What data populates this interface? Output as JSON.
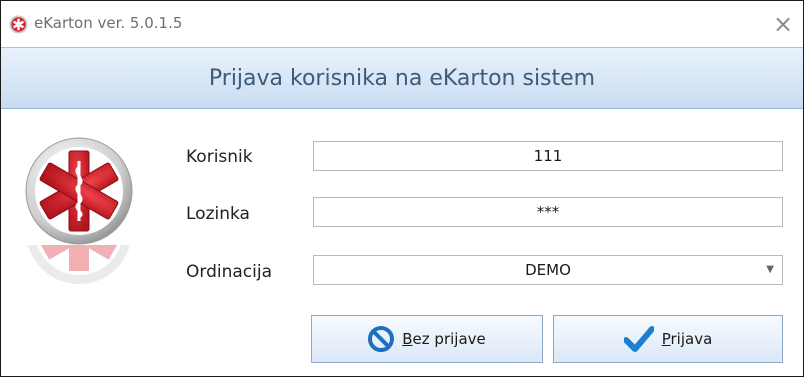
{
  "window": {
    "title": "eKarton ver. 5.0.1.5",
    "close_glyph": "×"
  },
  "header": {
    "title": "Prijava korisnika na eKarton sistem"
  },
  "logo": {
    "icon": "medical-star-of-life-icon",
    "color": "#d6202b"
  },
  "form": {
    "user_label": "Korisnik",
    "user_value": "111",
    "password_label": "Lozinka",
    "password_value": "***",
    "office_label": "Ordinacija",
    "office_value": "DEMO"
  },
  "buttons": {
    "cancel": {
      "mnemonic": "B",
      "rest": "ez prijave",
      "icon": "no-entry-icon"
    },
    "login": {
      "mnemonic": "P",
      "rest": "rijava",
      "icon": "checkmark-icon"
    }
  },
  "colors": {
    "header_text": "#3f5b7c",
    "accent_red": "#d6202b",
    "check_blue": "#1e7fd0"
  }
}
